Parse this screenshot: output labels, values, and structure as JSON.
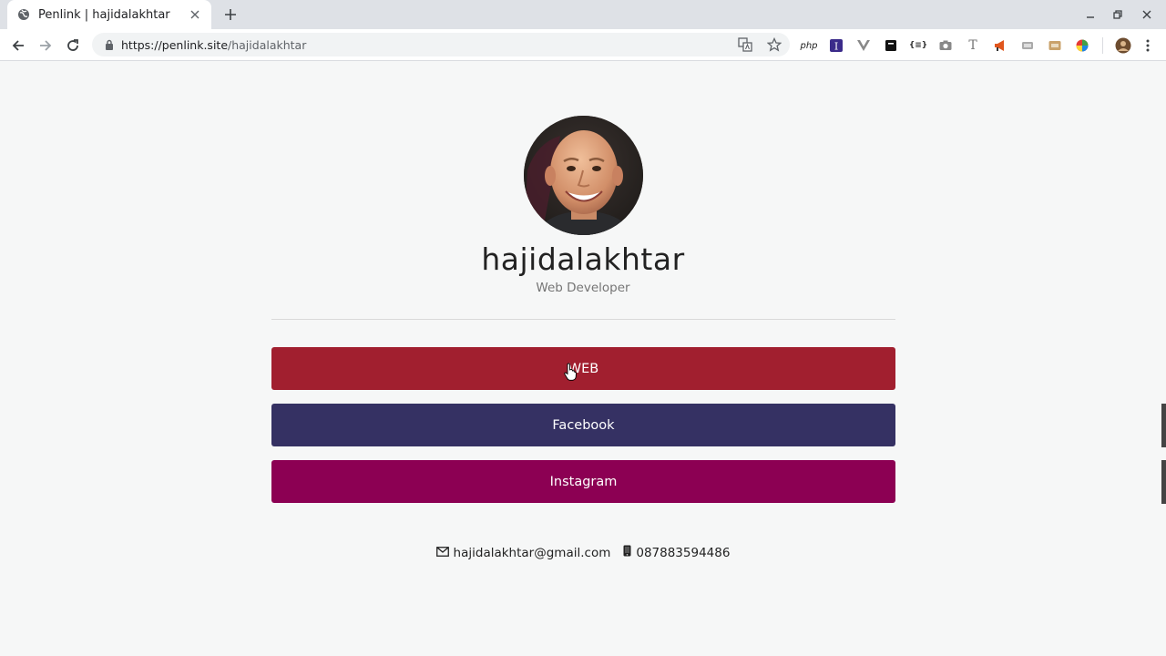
{
  "browser": {
    "tab": {
      "title": "Penlink | hajidalakhtar"
    },
    "url": {
      "host": "https://penlink.site",
      "path": "/hajidalakhtar"
    },
    "extensions": [
      "php",
      "I",
      "V",
      "",
      "{≡}",
      "",
      "T",
      "",
      "",
      "",
      "",
      ""
    ]
  },
  "profile": {
    "name": "hajidalakhtar",
    "role": "Web Developer"
  },
  "links": [
    {
      "label": "WEB",
      "color": "#a11f2f"
    },
    {
      "label": "Facebook",
      "color": "#353163"
    },
    {
      "label": "Instagram",
      "color": "#8c0053"
    }
  ],
  "contact": {
    "email": "hajidalakhtar@gmail.com",
    "phone": "087883594486"
  }
}
